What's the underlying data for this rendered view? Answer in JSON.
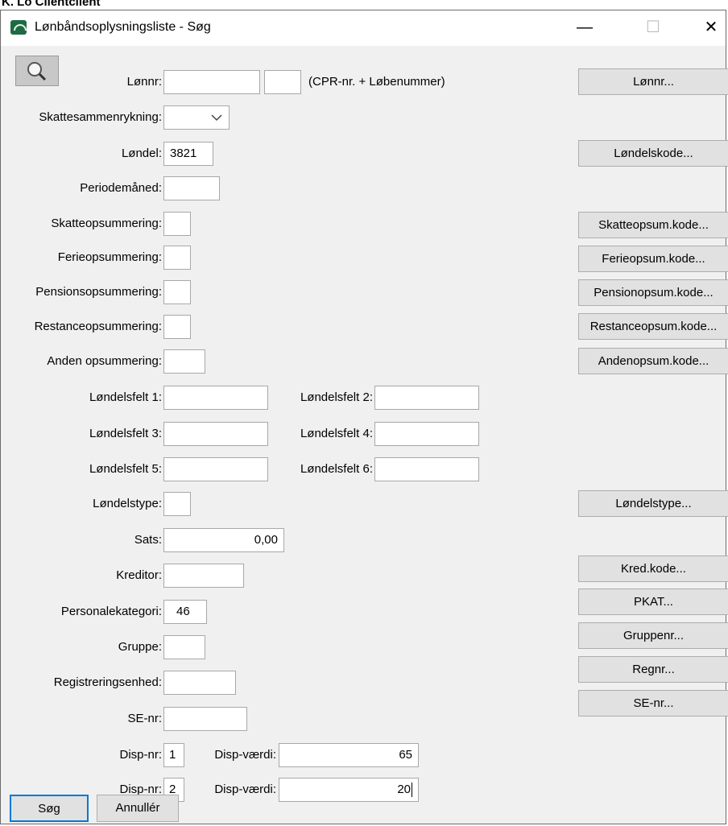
{
  "app_title_strip": "K. Lo Clientclient",
  "window": {
    "title": "Lønbåndsoplysningsliste - Søg",
    "minimize_glyph": "—",
    "maximize_glyph": "☐",
    "close_glyph": "✕"
  },
  "search_icon_name": "magnifier-icon",
  "fields": {
    "lonnr_label": "Lønnr:",
    "lonnr_value": "",
    "lobenr_value": "",
    "lonnr_hint": "(CPR-nr. + Løbenummer)",
    "skattesammenrykning_label": "Skattesammenrykning:",
    "skattesammenrykning_value": "",
    "londel_label": "Løndel:",
    "londel_value": "3821",
    "periodemaaned_label": "Periodemåned:",
    "periodemaaned_value": "",
    "skatteopsummering_label": "Skatteopsummering:",
    "ferieopsummering_label": "Ferieopsummering:",
    "pensionsopsummering_label": "Pensionsopsummering:",
    "restanceopsummering_label": "Restanceopsummering:",
    "anden_opsummering_label": "Anden opsummering:",
    "londelsfelt1_label": "Løndelsfelt 1:",
    "londelsfelt2_label": "Løndelsfelt 2:",
    "londelsfelt3_label": "Løndelsfelt 3:",
    "londelsfelt4_label": "Løndelsfelt 4:",
    "londelsfelt5_label": "Løndelsfelt 5:",
    "londelsfelt6_label": "Løndelsfelt 6:",
    "londelstype_label": "Løndelstype:",
    "sats_label": "Sats:",
    "sats_value": "0,00",
    "kreditor_label": "Kreditor:",
    "personalekategori_label": "Personalekategori:",
    "personalekategori_value": "46",
    "gruppe_label": "Gruppe:",
    "registreringsenhed_label": "Registreringsenhed:",
    "se_nr_label": "SE-nr:",
    "disp_nr_label": "Disp-nr:",
    "disp_vaerdi_label": "Disp-værdi:",
    "disp1_nr": "1",
    "disp1_vaerdi": "65",
    "disp2_nr": "2",
    "disp2_vaerdi": "20"
  },
  "lookup_buttons": {
    "lonnr": "Lønnr...",
    "londelskode": "Løndelskode...",
    "skatteopsum": "Skatteopsum.kode...",
    "ferieopsum": "Ferieopsum.kode...",
    "pensionopsum": "Pensionopsum.kode...",
    "restanceopsum": "Restanceopsum.kode...",
    "andenopsum": "Andenopsum.kode...",
    "londelstype": "Løndelstype...",
    "kredkode": "Kred.kode...",
    "pkat": "PKAT...",
    "gruppenr": "Gruppenr...",
    "regnr": "Regnr...",
    "senr": "SE-nr..."
  },
  "footer": {
    "search_button": "Søg",
    "cancel_button": "Annullér"
  }
}
